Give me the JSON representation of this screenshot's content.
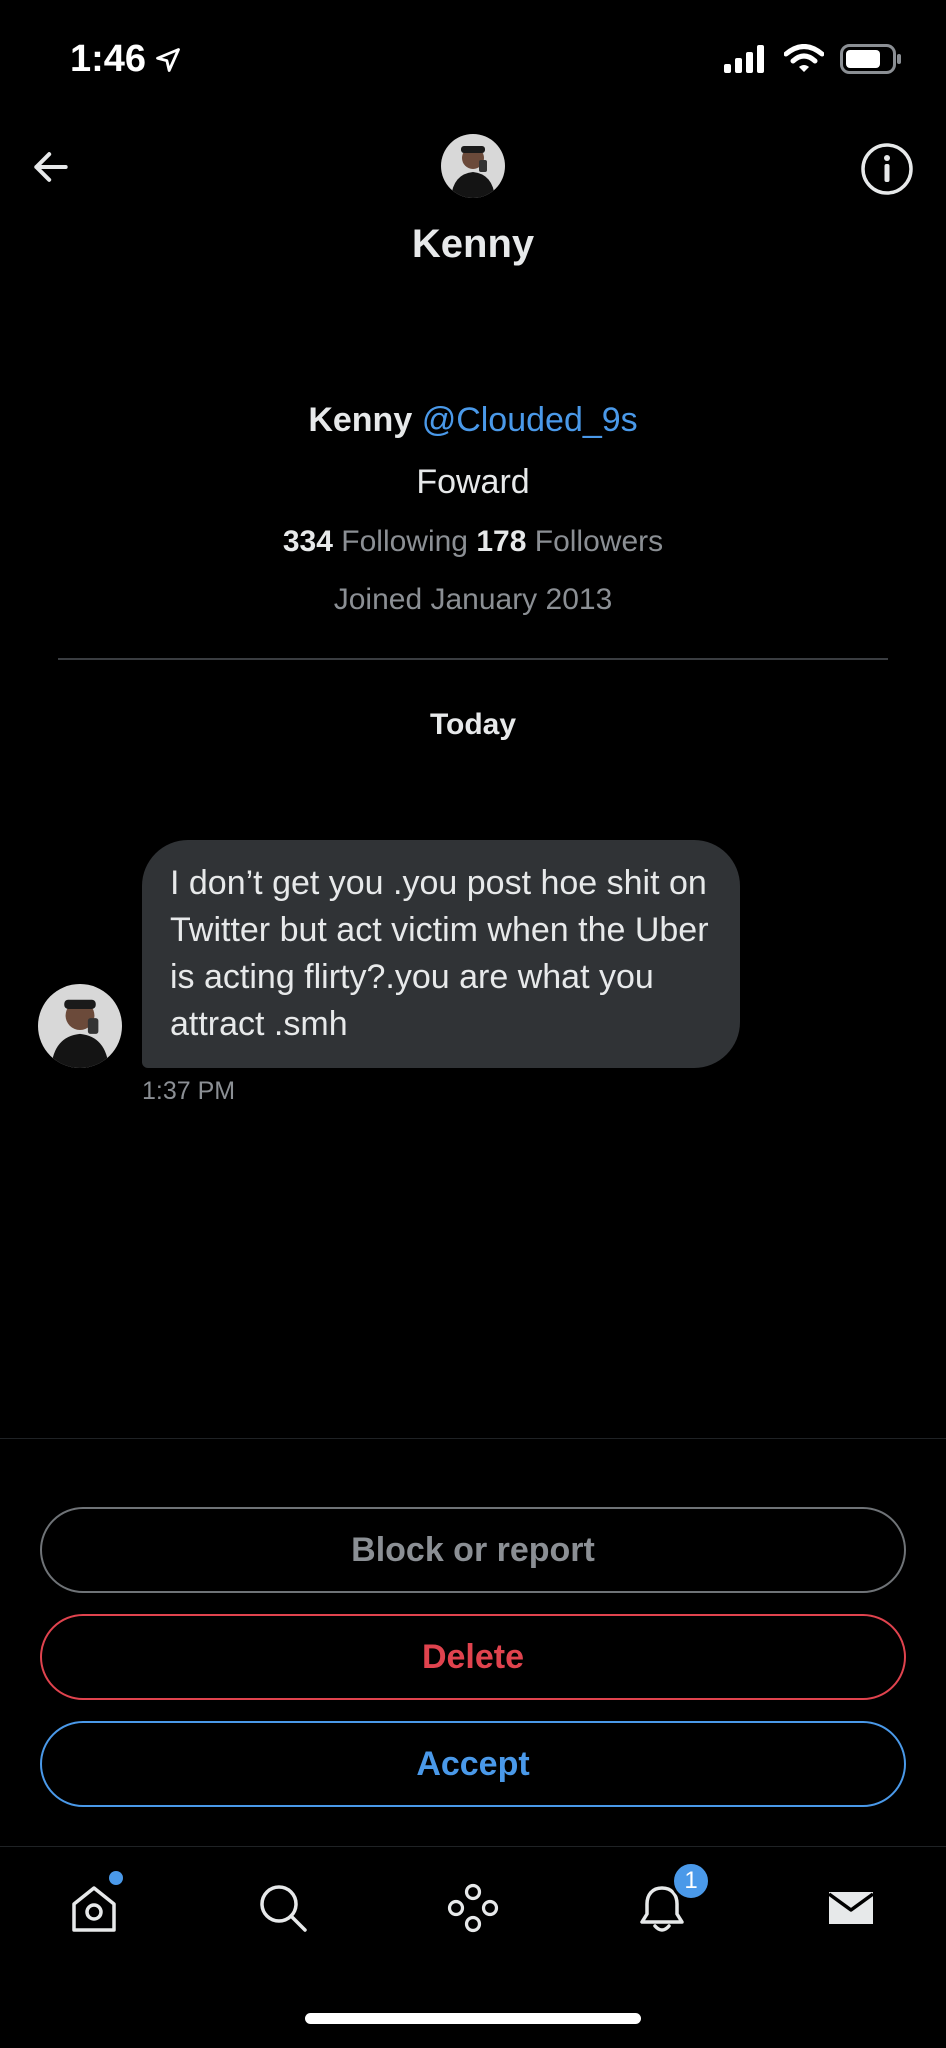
{
  "status_bar": {
    "time": "1:46",
    "location_icon": "location-arrow-icon",
    "signal_icon": "cellular-signal-icon",
    "wifi_icon": "wifi-icon",
    "battery_icon": "battery-icon"
  },
  "header": {
    "title": "Kenny",
    "back_icon": "arrow-left-icon",
    "info_icon": "info-circle-icon"
  },
  "profile": {
    "name": "Kenny",
    "handle": "@Clouded_9s",
    "bio": "Foward",
    "following_count": "334",
    "following_label": "Following",
    "followers_count": "178",
    "followers_label": "Followers",
    "joined": "Joined January 2013"
  },
  "conversation": {
    "day_label": "Today",
    "messages": [
      {
        "text": "I don’t get you .you post hoe shit on Twitter but act victim when the Uber is acting flirty?.you are what you attract .smh",
        "time": "1:37 PM"
      }
    ]
  },
  "actions": {
    "block_label": "Block or report",
    "delete_label": "Delete",
    "accept_label": "Accept"
  },
  "tab_bar": {
    "notifications_badge": "1",
    "tabs": [
      "home-icon",
      "search-icon",
      "spaces-icon",
      "bell-icon",
      "mail-icon"
    ]
  },
  "colors": {
    "background": "#000000",
    "accent_blue": "#4a99e9",
    "danger_red": "#e0434e",
    "bubble_gray": "#303336",
    "muted_text": "#8b8f94"
  }
}
